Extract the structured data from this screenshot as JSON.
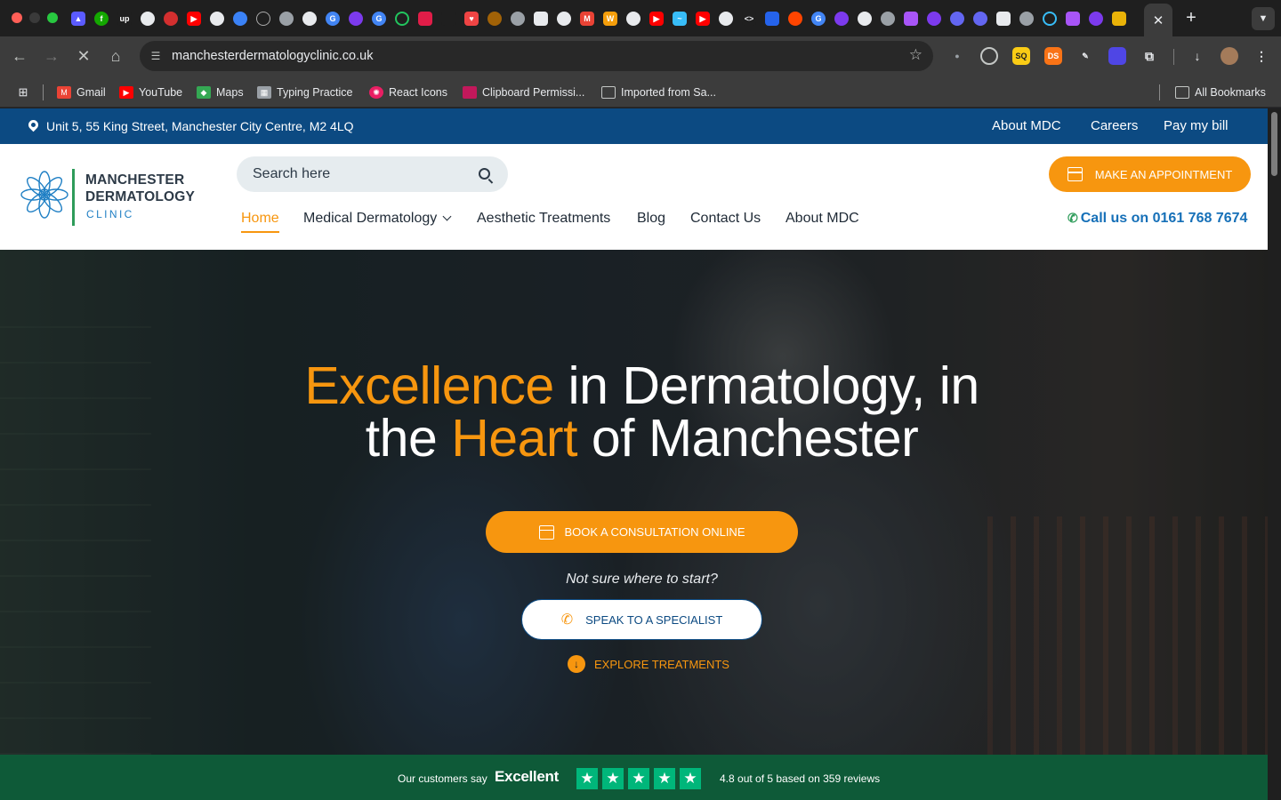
{
  "browser": {
    "url": "manchesterdermatologyclinic.co.uk",
    "bookmarks": [
      {
        "label": "Gmail",
        "icon": "gmail-icon",
        "color": "#ea4335"
      },
      {
        "label": "YouTube",
        "icon": "youtube-icon",
        "color": "#ff0000"
      },
      {
        "label": "Maps",
        "icon": "maps-icon",
        "color": "#34a853"
      },
      {
        "label": "Typing Practice",
        "icon": "keyboard-icon",
        "color": "#9aa0a6"
      },
      {
        "label": "React Icons",
        "icon": "react-icon",
        "color": "#e91e63"
      },
      {
        "label": "Clipboard Permissi...",
        "icon": "page-icon",
        "color": "#c2185b"
      },
      {
        "label": "Imported from Sa...",
        "icon": "folder-icon",
        "color": "#3c3c3c"
      }
    ],
    "all_bookmarks": "All Bookmarks"
  },
  "colors": {
    "brand_blue": "#0c4a82",
    "accent_orange": "#f7960f",
    "brand_green": "#2e9c5a",
    "trustpilot_green": "#00b67a"
  },
  "site": {
    "topbar": {
      "address": "Unit 5, 55 King Street, Manchester City Centre, M2 4LQ",
      "links": [
        "About MDC",
        "Careers",
        "Pay my bill"
      ]
    },
    "logo": {
      "line1": "MANCHESTER",
      "line2": "DERMATOLOGY",
      "line3": "CLINIC"
    },
    "search": {
      "placeholder": "Search here"
    },
    "appointment_label": "MAKE AN APPOINTMENT",
    "nav": [
      {
        "label": "Home",
        "active": true
      },
      {
        "label": "Medical Dermatology",
        "dropdown": true
      },
      {
        "label": "Aesthetic Treatments"
      },
      {
        "label": "Blog"
      },
      {
        "label": "Contact Us"
      },
      {
        "label": "About MDC"
      }
    ],
    "call": "Call us on 0161 768 7674",
    "hero": {
      "headline": {
        "w1": "Excellence",
        "w2": " in Dermatology, in",
        "w3": "the ",
        "w4": "Heart",
        "w5": " of Manchester"
      },
      "book_label": "BOOK A CONSULTATION ONLINE",
      "not_sure": "Not sure where to start?",
      "speak_label": "SPEAK TO A SPECIALIST",
      "explore_label": "EXPLORE TREATMENTS"
    },
    "trust": {
      "say": "Our customers say",
      "excellent": "Excellent",
      "stars": 5,
      "rating": "4.8 out of 5 based on 359 reviews"
    }
  }
}
